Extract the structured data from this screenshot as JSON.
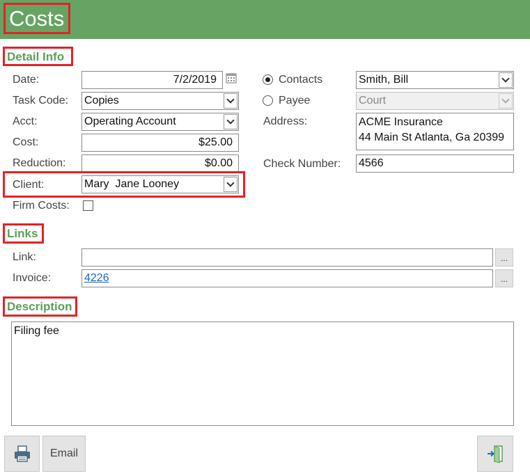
{
  "window": {
    "title": "Costs"
  },
  "sections": {
    "detail_info": "Detail Info",
    "links": "Links",
    "description": "Description"
  },
  "detail": {
    "date_label": "Date:",
    "date_value": "7/2/2019",
    "task_code_label": "Task Code:",
    "task_code_value": "Copies",
    "acct_label": "Acct:",
    "acct_value": "Operating Account",
    "cost_label": "Cost:",
    "cost_value": "$25.00",
    "reduction_label": "Reduction:",
    "reduction_value": "$0.00",
    "client_label": "Client:",
    "client_value": "Mary  Jane Looney",
    "firm_costs_label": "Firm Costs:",
    "firm_costs_checked": false
  },
  "payee": {
    "contacts_label": "Contacts",
    "contacts_selected": true,
    "contacts_value": "Smith, Bill",
    "payee_label": "Payee",
    "payee_value": "Court",
    "address_label": "Address:",
    "address_line1": "ACME Insurance",
    "address_line2": "44 Main St Atlanta, Ga 20399",
    "check_number_label": "Check Number:",
    "check_number_value": "4566"
  },
  "links": {
    "link_label": "Link:",
    "link_value": "",
    "invoice_label": "Invoice:",
    "invoice_value": "4226",
    "browse_label": "..."
  },
  "description": {
    "text": "Filing fee"
  },
  "footer": {
    "email_label": "Email",
    "print_icon": "printer-icon",
    "exit_icon": "exit-door-icon"
  },
  "colors": {
    "header_green": "#67a463",
    "section_green": "#5aa05a",
    "highlight_red": "#e32227",
    "link_blue": "#1a66b8"
  }
}
